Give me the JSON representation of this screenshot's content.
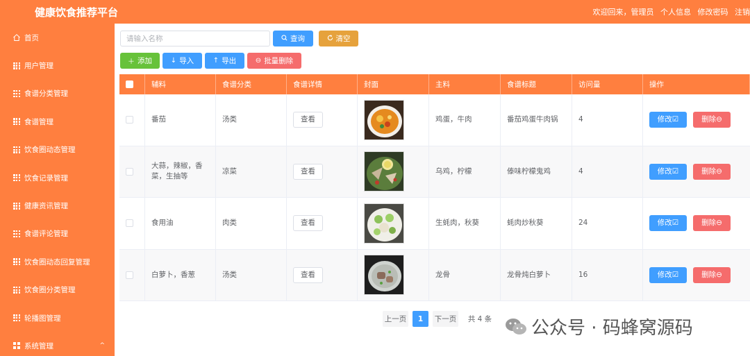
{
  "app": {
    "title": "健康饮食推荐平台"
  },
  "topbar": {
    "welcome": "欢迎回来，管理员",
    "links": [
      "个人信息",
      "修改密码",
      "注销"
    ]
  },
  "sidebar": {
    "items": [
      {
        "label": "首页",
        "icon": "home-icon"
      },
      {
        "label": "用户管理",
        "icon": "grid-icon"
      },
      {
        "label": "食谱分类管理",
        "icon": "grid-icon"
      },
      {
        "label": "食谱管理",
        "icon": "grid-icon"
      },
      {
        "label": "饮食圈动态管理",
        "icon": "grid-icon"
      },
      {
        "label": "饮食记录管理",
        "icon": "grid-icon"
      },
      {
        "label": "健康资讯管理",
        "icon": "grid-icon"
      },
      {
        "label": "食谱评论管理",
        "icon": "grid-icon"
      },
      {
        "label": "饮食圈动态回复管理",
        "icon": "grid-icon"
      },
      {
        "label": "饮食圈分类管理",
        "icon": "grid-icon"
      },
      {
        "label": "轮播图管理",
        "icon": "grid-icon"
      },
      {
        "label": "系统管理",
        "icon": "grid4-icon",
        "chevron": "^"
      }
    ]
  },
  "search": {
    "placeholder": "请输入名称",
    "value": "",
    "query_label": "查询",
    "clear_label": "清空"
  },
  "toolbar": {
    "add_label": "添加",
    "import_label": "导入",
    "export_label": "导出",
    "batch_delete_label": "批量删除"
  },
  "table": {
    "headers": [
      "辅料",
      "食谱分类",
      "食谱详情",
      "封面",
      "主料",
      "食谱标题",
      "访问量",
      "操作"
    ],
    "view_label": "查看",
    "edit_label": "修改",
    "delete_label": "删除",
    "rows": [
      {
        "fuliao": "番茄",
        "category": "汤类",
        "zhuliao": "鸡蛋，牛肉",
        "title": "番茄鸡蛋牛肉锅",
        "visits": "4"
      },
      {
        "fuliao": "大蒜，辣椒，香菜，生抽等",
        "category": "凉菜",
        "zhuliao": "乌鸡，柠檬",
        "title": "傣味柠檬鬼鸡",
        "visits": "4"
      },
      {
        "fuliao": "食用油",
        "category": "肉类",
        "zhuliao": "生蚝肉，秋葵",
        "title": "蚝肉炒秋葵",
        "visits": "24"
      },
      {
        "fuliao": "白萝卜，香葱",
        "category": "汤类",
        "zhuliao": "龙骨",
        "title": "龙骨炖白萝卜",
        "visits": "16"
      }
    ]
  },
  "pagination": {
    "prev_label": "上一页",
    "current": "1",
    "next_label": "下一页",
    "total_label": "共 4 条"
  },
  "watermark": {
    "text": "公众号 · 码蜂窝源码"
  },
  "colors": {
    "primary": "#ff7f3f",
    "blue": "#409eff",
    "orange": "#e6a23c",
    "green": "#67c23a",
    "red": "#f56c6c"
  }
}
